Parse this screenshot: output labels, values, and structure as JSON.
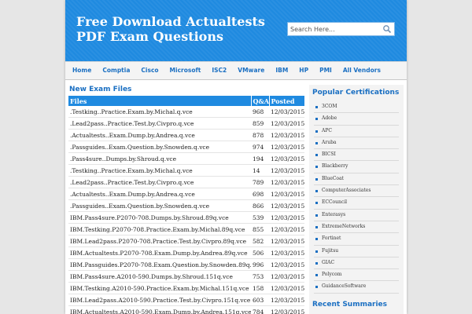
{
  "header": {
    "title_line1": "Free Download Actualtests",
    "title_line2": "PDF Exam Questions"
  },
  "search": {
    "placeholder": "Search Here..."
  },
  "nav": [
    "Home",
    "Comptia",
    "Cisco",
    "Microsoft",
    "ISC2",
    "VMware",
    "IBM",
    "HP",
    "PMI",
    "All Vendors"
  ],
  "main": {
    "section_title": "New Exam Files",
    "columns": [
      "Files",
      "Q&A",
      "Posted"
    ],
    "rows": [
      [
        ".Testking..Practice.Exam.by.Michal.q.vce",
        "968",
        "12/03/2015"
      ],
      [
        ".Lead2pass..Practice.Test.by.Civpro.q.vce",
        "859",
        "12/03/2015"
      ],
      [
        ".Actualtests..Exam.Dump.by.Andrea.q.vce",
        "878",
        "12/03/2015"
      ],
      [
        ".Passguides..Exam.Question.by.Snowden.q.vce",
        "974",
        "12/03/2015"
      ],
      [
        ".Pass4sure..Dumps.by.Shroud.q.vce",
        "194",
        "12/03/2015"
      ],
      [
        ".Testking..Practice.Exam.by.Michal.q.vce",
        "14",
        "12/03/2015"
      ],
      [
        ".Lead2pass..Practice.Test.by.Civpro.q.vce",
        "789",
        "12/03/2015"
      ],
      [
        ".Actualtests..Exam.Dump.by.Andrea.q.vce",
        "698",
        "12/03/2015"
      ],
      [
        ".Passguides..Exam.Question.by.Snowden.q.vce",
        "866",
        "12/03/2015"
      ],
      [
        "IBM.Pass4sure.P2070-708.Dumps.by.Shroud.89q.vce",
        "539",
        "12/03/2015"
      ],
      [
        "IBM.Testking.P2070-708.Practice.Exam.by.Michal.89q.vce",
        "855",
        "12/03/2015"
      ],
      [
        "IBM.Lead2pass.P2070-708.Practice.Test.by.Civpro.89q.vce",
        "582",
        "12/03/2015"
      ],
      [
        "IBM.Actualtests.P2070-708.Exam.Dump.by.Andrea.89q.vce",
        "506",
        "12/03/2015"
      ],
      [
        "IBM.Passguides.P2070-708.Exam.Question.by.Snowden.89q.vce",
        "996",
        "12/03/2015"
      ],
      [
        "IBM.Pass4sure.A2010-590.Dumps.by.Shroud.151q.vce",
        "753",
        "12/03/2015"
      ],
      [
        "IBM.Testking.A2010-590.Practice.Exam.by.Michal.151q.vce",
        "158",
        "12/03/2015"
      ],
      [
        "IBM.Lead2pass.A2010-590.Practice.Test.by.Civpro.151q.vce",
        "603",
        "12/03/2015"
      ],
      [
        "IBM.Actualtests.A2010-590.Exam.Dump.by.Andrea.151q.vce",
        "784",
        "12/03/2015"
      ],
      [
        "IBM.Passguides.A2010-",
        "",
        ""
      ]
    ]
  },
  "sidebar": {
    "popular_title": "Popular Certifications",
    "certifications": [
      "3COM",
      "Adobe",
      "APC",
      "Aruba",
      "BICSI",
      "Blackberry",
      "BlueCoat",
      "ComputerAssociates",
      "ECCouncil",
      "Enterasys",
      "ExtremeNetworks",
      "Fortinet",
      "Fujitsu",
      "GIAC",
      "Polycom",
      "GuidanceSoftware"
    ],
    "recent_title": "Recent Summaries"
  },
  "colors": {
    "header_blue": "#1f8ae0",
    "link_blue": "#1a6fc2"
  }
}
